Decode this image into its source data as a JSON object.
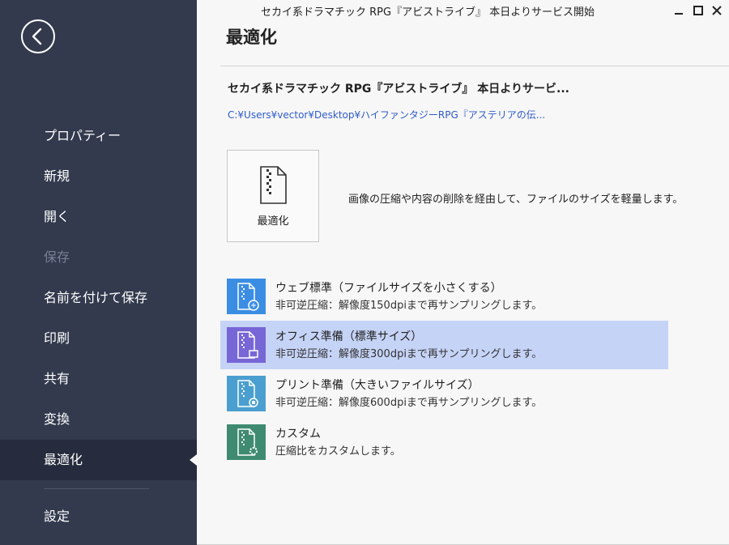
{
  "window": {
    "title": "セカイ系ドラマチック RPG『アビストライブ』 本日よりサービス開始"
  },
  "sidebar": {
    "items": [
      {
        "label": "プロパティー"
      },
      {
        "label": "新規"
      },
      {
        "label": "開く"
      },
      {
        "label": "保存",
        "disabled": true
      },
      {
        "label": "名前を付けて保存"
      },
      {
        "label": "印刷"
      },
      {
        "label": "共有"
      },
      {
        "label": "変換"
      },
      {
        "label": "最適化",
        "active": true
      }
    ],
    "settings_label": "設定"
  },
  "main": {
    "title": "最適化",
    "doc_title": "セカイ系ドラマチック RPG『アビストライブ』 本日よりサービ...",
    "doc_path": "C:¥Users¥vector¥Desktop¥ハイファンタジーRPG『アステリアの伝...",
    "optimize_button_label": "最適化",
    "optimize_description": "画像の圧縮や内容の削除を経由して、ファイルのサイズを軽量します。",
    "options": [
      {
        "name": "ウェブ標準（ファイルサイズを小さくする）",
        "desc": "非可逆圧縮：解像度150dpiまで再サンプリングします。",
        "color": "#3b8de4",
        "icon": "web-icon"
      },
      {
        "name": "オフィス準備（標準サイズ）",
        "desc": "非可逆圧縮：解像度300dpiまで再サンプリングします。",
        "color": "#7766d6",
        "icon": "office-icon",
        "selected": true
      },
      {
        "name": "プリント準備（大きいファイルサイズ）",
        "desc": "非可逆圧縮：解像度600dpiまで再サンプリングします。",
        "color": "#4a9fd0",
        "icon": "print-icon"
      },
      {
        "name": "カスタム",
        "desc": "圧縮比をカスタムします。",
        "color": "#3f8b72",
        "icon": "custom-icon"
      }
    ]
  },
  "colors": {
    "sidebar_bg": "#333a4e",
    "sidebar_active_bg": "#262c3d",
    "selected_row_bg": "#c5d3f6",
    "link_color": "#2f5bc9"
  }
}
